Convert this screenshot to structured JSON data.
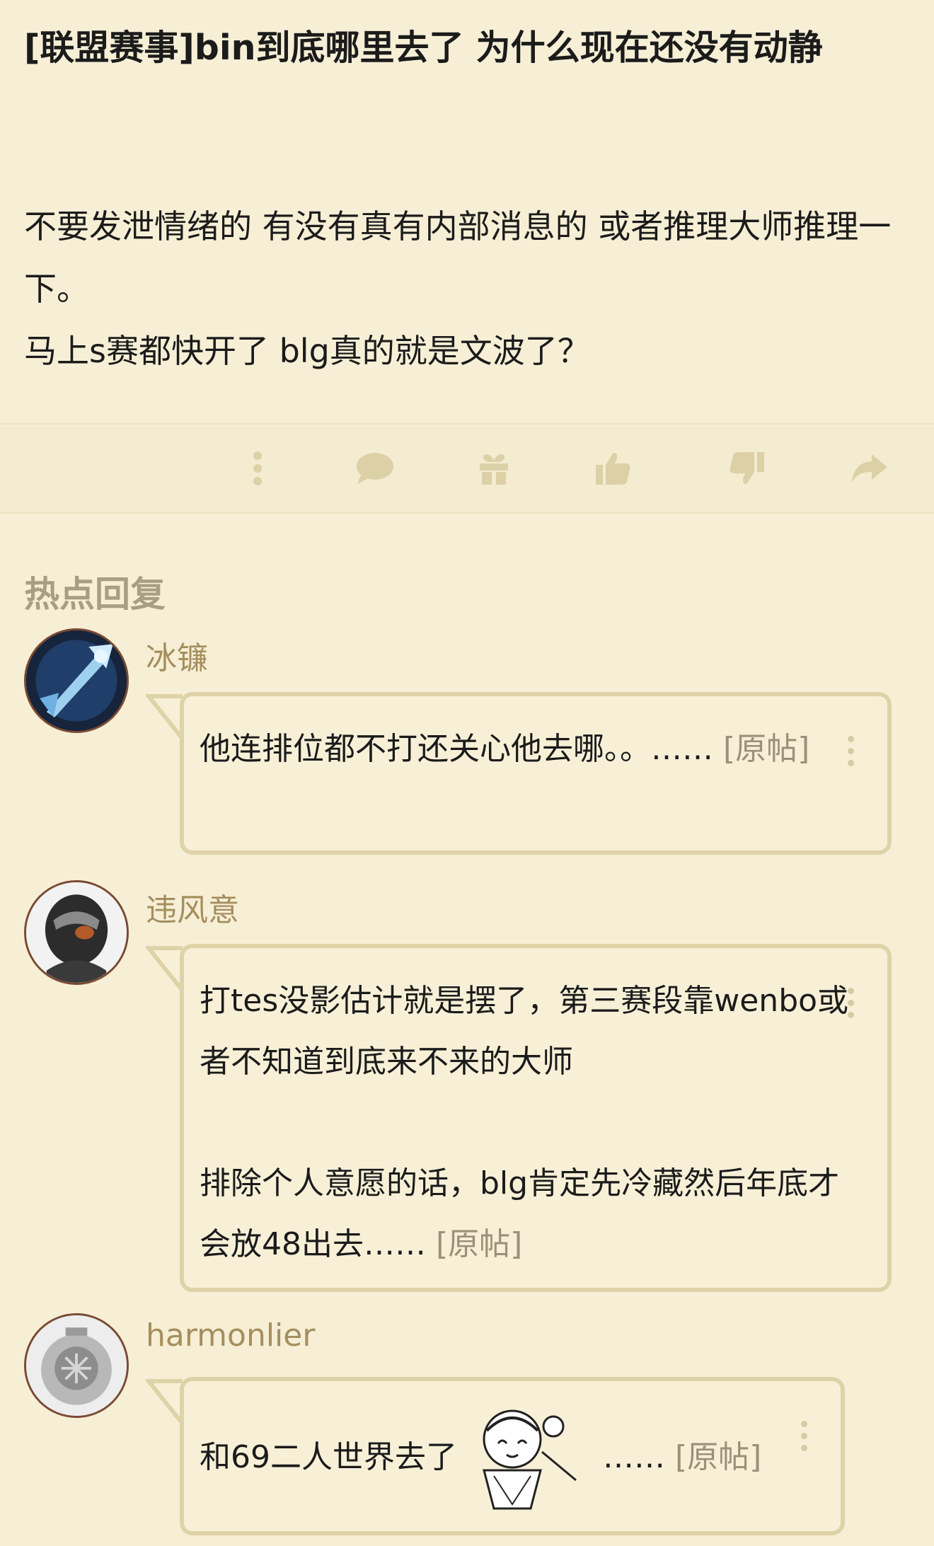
{
  "post": {
    "title": "[联盟赛事]bin到底哪里去了 为什么现在还没有动静",
    "body": [
      "不要发泄情绪的 有没有真有内部消息的 或者推理大师推理一下。",
      "马上s赛都快开了 blg真的就是文波了？"
    ]
  },
  "actions": {
    "icons": [
      "more-icon",
      "comment-icon",
      "gift-icon",
      "thumbs-up-icon",
      "thumbs-down-icon",
      "share-icon"
    ]
  },
  "hot_replies": {
    "heading": "热点回复",
    "replies": [
      {
        "username": "冰镰",
        "text": "他连排位都不打还关心他去哪。。……",
        "link": "[原帖]"
      },
      {
        "username": "违风意",
        "text_lines": [
          "打tes没影估计就是摆了，第三赛段靠wenbo或者不知道到底来不来的大师",
          "排除个人意愿的话，blg肯定先冷藏然后年底才会放48出去……"
        ],
        "link": "[原帖]"
      },
      {
        "username": "harmonlier",
        "text": "和69二人世界去了",
        "text_after": "……",
        "link": "[原帖]"
      }
    ]
  },
  "colors": {
    "background": "#f6efd6",
    "bubble_border": "#ded3a8",
    "username": "#a58e5e",
    "heading": "#a89e84",
    "icon": "#dcd0a6"
  }
}
